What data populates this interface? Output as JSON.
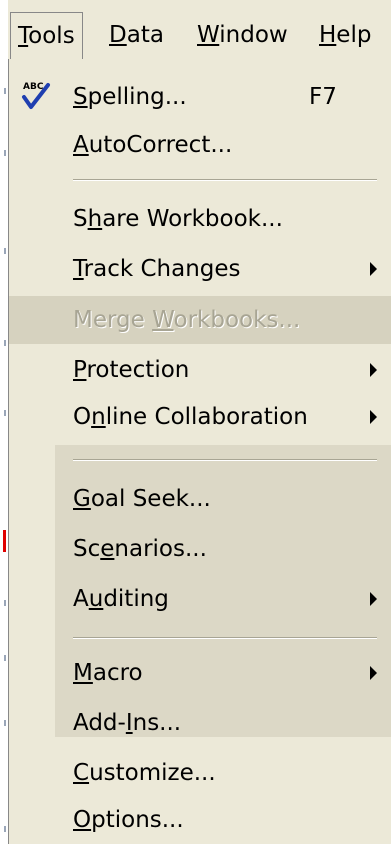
{
  "menubar": {
    "items": [
      {
        "label_pre": "",
        "accel": "T",
        "label_post": "ools",
        "active": true
      },
      {
        "label_pre": "",
        "accel": "D",
        "label_post": "ata",
        "active": false
      },
      {
        "label_pre": "",
        "accel": "W",
        "label_post": "indow",
        "active": false
      },
      {
        "label_pre": "",
        "accel": "H",
        "label_post": "elp",
        "active": false
      }
    ]
  },
  "tools_menu": {
    "spelling": {
      "pre": "",
      "accel": "S",
      "post": "pelling...",
      "shortcut": "F7",
      "icon_text": "ABC"
    },
    "autocorrect": {
      "pre": "",
      "accel": "A",
      "post": "utoCorrect..."
    },
    "share_workbook": {
      "pre": "S",
      "accel": "h",
      "post": "are Workbook..."
    },
    "track_changes": {
      "pre": "",
      "accel": "T",
      "post": "rack Changes"
    },
    "merge_workbooks": {
      "pre": "Merge ",
      "accel": "W",
      "post": "orkbooks..."
    },
    "protection": {
      "pre": "",
      "accel": "P",
      "post": "rotection"
    },
    "online_collaboration": {
      "pre": "O",
      "accel": "n",
      "post": "line Collaboration"
    },
    "goal_seek": {
      "pre": "",
      "accel": "G",
      "post": "oal Seek..."
    },
    "scenarios": {
      "pre": "Sc",
      "accel": "e",
      "post": "narios..."
    },
    "auditing": {
      "pre": "A",
      "accel": "u",
      "post": "diting"
    },
    "macro": {
      "pre": "",
      "accel": "M",
      "post": "acro"
    },
    "add_ins": {
      "pre": "Add-",
      "accel": "I",
      "post": "ns..."
    },
    "customize": {
      "pre": "",
      "accel": "C",
      "post": "ustomize..."
    },
    "options": {
      "pre": "",
      "accel": "O",
      "post": "ptions..."
    }
  },
  "colors": {
    "menu_bg": "#ece9d8",
    "rare_bg": "#dcd8c6",
    "disabled_text": "#a8a594",
    "check_blue": "#1f3fb0"
  }
}
